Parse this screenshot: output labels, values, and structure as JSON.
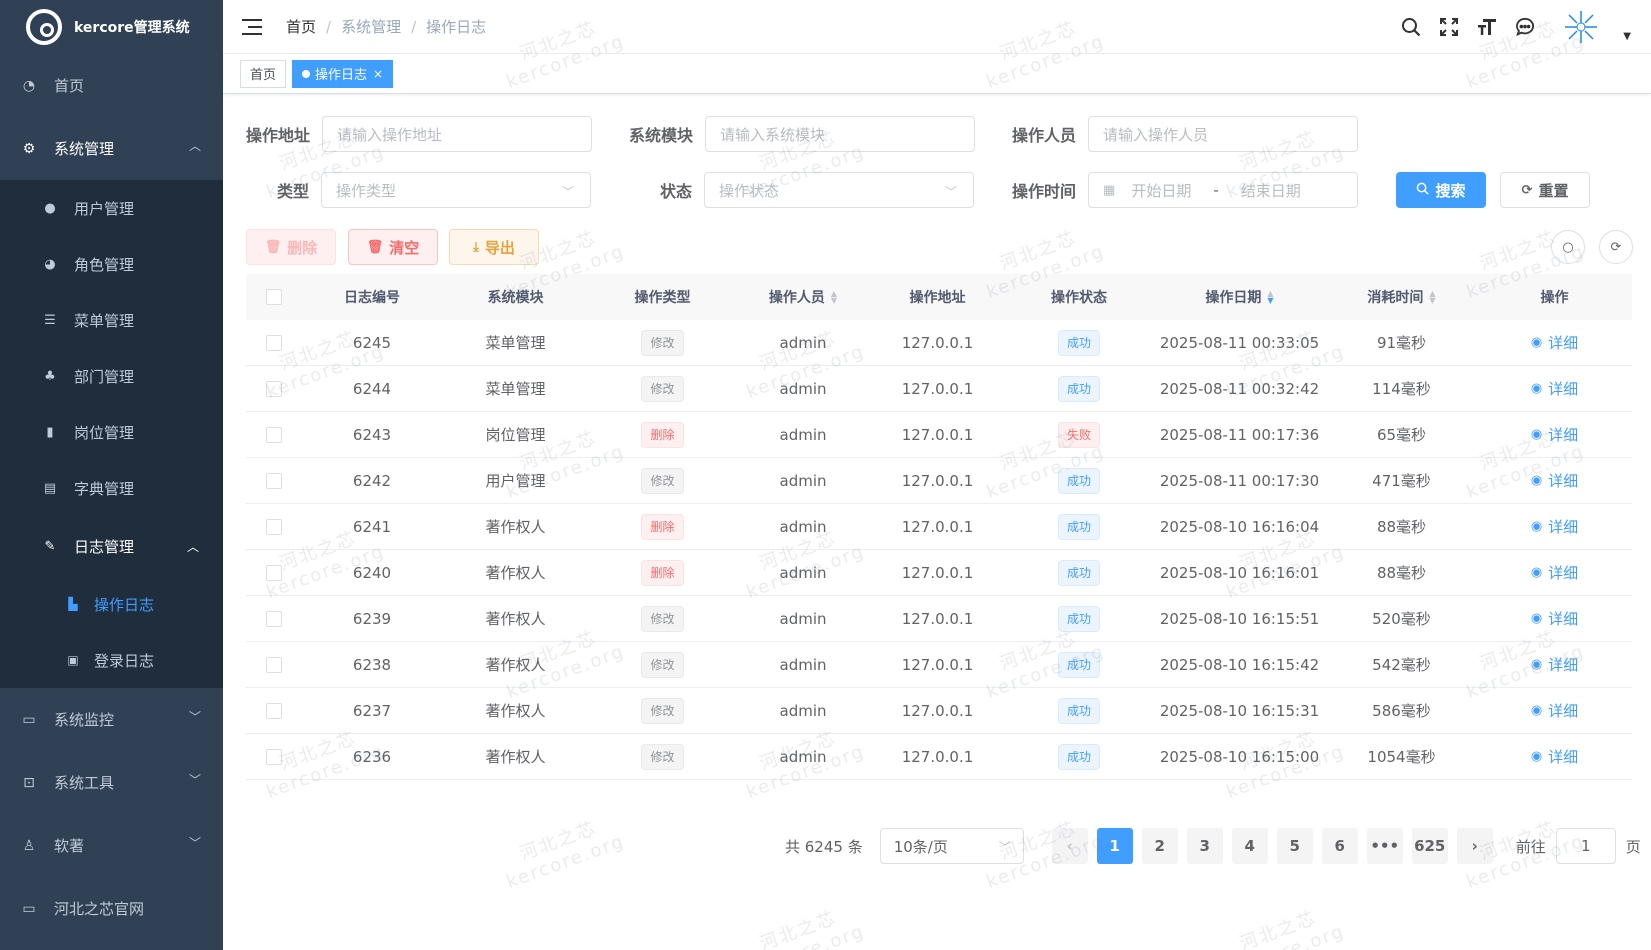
{
  "app": {
    "title": "kercore管理系统"
  },
  "sidebar": {
    "home": "首页",
    "system": "系统管理",
    "system_items": [
      "用户管理",
      "角色管理",
      "菜单管理",
      "部门管理",
      "岗位管理",
      "字典管理"
    ],
    "log": "日志管理",
    "log_items": [
      "操作日志",
      "登录日志"
    ],
    "monitor": "系统监控",
    "tools": "系统工具",
    "software": "软著",
    "website": "河北之芯官网"
  },
  "breadcrumb": [
    "首页",
    "系统管理",
    "操作日志"
  ],
  "tags": {
    "home": "首页",
    "current": "操作日志"
  },
  "search": {
    "addr_label": "操作地址",
    "addr_placeholder": "请输入操作地址",
    "module_label": "系统模块",
    "module_placeholder": "请输入系统模块",
    "oper_label": "操作人员",
    "oper_placeholder": "请输入操作人员",
    "type_label": "类型",
    "type_placeholder": "操作类型",
    "status_label": "状态",
    "status_placeholder": "操作状态",
    "time_label": "操作时间",
    "start_placeholder": "开始日期",
    "range_sep": "-",
    "end_placeholder": "结束日期",
    "search_btn": "搜索",
    "reset_btn": "重置"
  },
  "toolbar": {
    "delete": "删除",
    "clear": "清空",
    "export": "导出"
  },
  "table": {
    "headers": [
      "日志编号",
      "系统模块",
      "操作类型",
      "操作人员",
      "操作地址",
      "操作状态",
      "操作日期",
      "消耗时间",
      "操作"
    ],
    "detail_label": "详细",
    "rows": [
      {
        "id": "6245",
        "module": "菜单管理",
        "type": "修改",
        "type_kind": "info",
        "oper": "admin",
        "addr": "127.0.0.1",
        "status": "成功",
        "status_kind": "success",
        "date": "2025-08-11 00:33:05",
        "cost": "91毫秒"
      },
      {
        "id": "6244",
        "module": "菜单管理",
        "type": "修改",
        "type_kind": "info",
        "oper": "admin",
        "addr": "127.0.0.1",
        "status": "成功",
        "status_kind": "success",
        "date": "2025-08-11 00:32:42",
        "cost": "114毫秒"
      },
      {
        "id": "6243",
        "module": "岗位管理",
        "type": "删除",
        "type_kind": "danger",
        "oper": "admin",
        "addr": "127.0.0.1",
        "status": "失败",
        "status_kind": "danger",
        "date": "2025-08-11 00:17:36",
        "cost": "65毫秒"
      },
      {
        "id": "6242",
        "module": "用户管理",
        "type": "修改",
        "type_kind": "info",
        "oper": "admin",
        "addr": "127.0.0.1",
        "status": "成功",
        "status_kind": "success",
        "date": "2025-08-11 00:17:30",
        "cost": "471毫秒"
      },
      {
        "id": "6241",
        "module": "著作权人",
        "type": "删除",
        "type_kind": "danger",
        "oper": "admin",
        "addr": "127.0.0.1",
        "status": "成功",
        "status_kind": "success",
        "date": "2025-08-10 16:16:04",
        "cost": "88毫秒"
      },
      {
        "id": "6240",
        "module": "著作权人",
        "type": "删除",
        "type_kind": "danger",
        "oper": "admin",
        "addr": "127.0.0.1",
        "status": "成功",
        "status_kind": "success",
        "date": "2025-08-10 16:16:01",
        "cost": "88毫秒"
      },
      {
        "id": "6239",
        "module": "著作权人",
        "type": "修改",
        "type_kind": "info",
        "oper": "admin",
        "addr": "127.0.0.1",
        "status": "成功",
        "status_kind": "success",
        "date": "2025-08-10 16:15:51",
        "cost": "520毫秒"
      },
      {
        "id": "6238",
        "module": "著作权人",
        "type": "修改",
        "type_kind": "info",
        "oper": "admin",
        "addr": "127.0.0.1",
        "status": "成功",
        "status_kind": "success",
        "date": "2025-08-10 16:15:42",
        "cost": "542毫秒"
      },
      {
        "id": "6237",
        "module": "著作权人",
        "type": "修改",
        "type_kind": "info",
        "oper": "admin",
        "addr": "127.0.0.1",
        "status": "成功",
        "status_kind": "success",
        "date": "2025-08-10 16:15:31",
        "cost": "586毫秒"
      },
      {
        "id": "6236",
        "module": "著作权人",
        "type": "修改",
        "type_kind": "info",
        "oper": "admin",
        "addr": "127.0.0.1",
        "status": "成功",
        "status_kind": "success",
        "date": "2025-08-10 16:15:00",
        "cost": "1054毫秒"
      }
    ]
  },
  "pagination": {
    "total": "共 6245 条",
    "page_size": "10条/页",
    "pages": [
      "1",
      "2",
      "3",
      "4",
      "5",
      "6",
      "•••",
      "625"
    ],
    "current": "1",
    "goto_prefix": "前往",
    "goto_value": "1",
    "goto_suffix": "页"
  },
  "watermark": {
    "line1": "河北之芯",
    "line2": "kercore.org"
  },
  "colors": {
    "sidebar_bg": "#304156",
    "submenu_bg": "#1f2d3d",
    "primary": "#409eff",
    "danger": "#f56c6c",
    "warning": "#e6a23c"
  }
}
